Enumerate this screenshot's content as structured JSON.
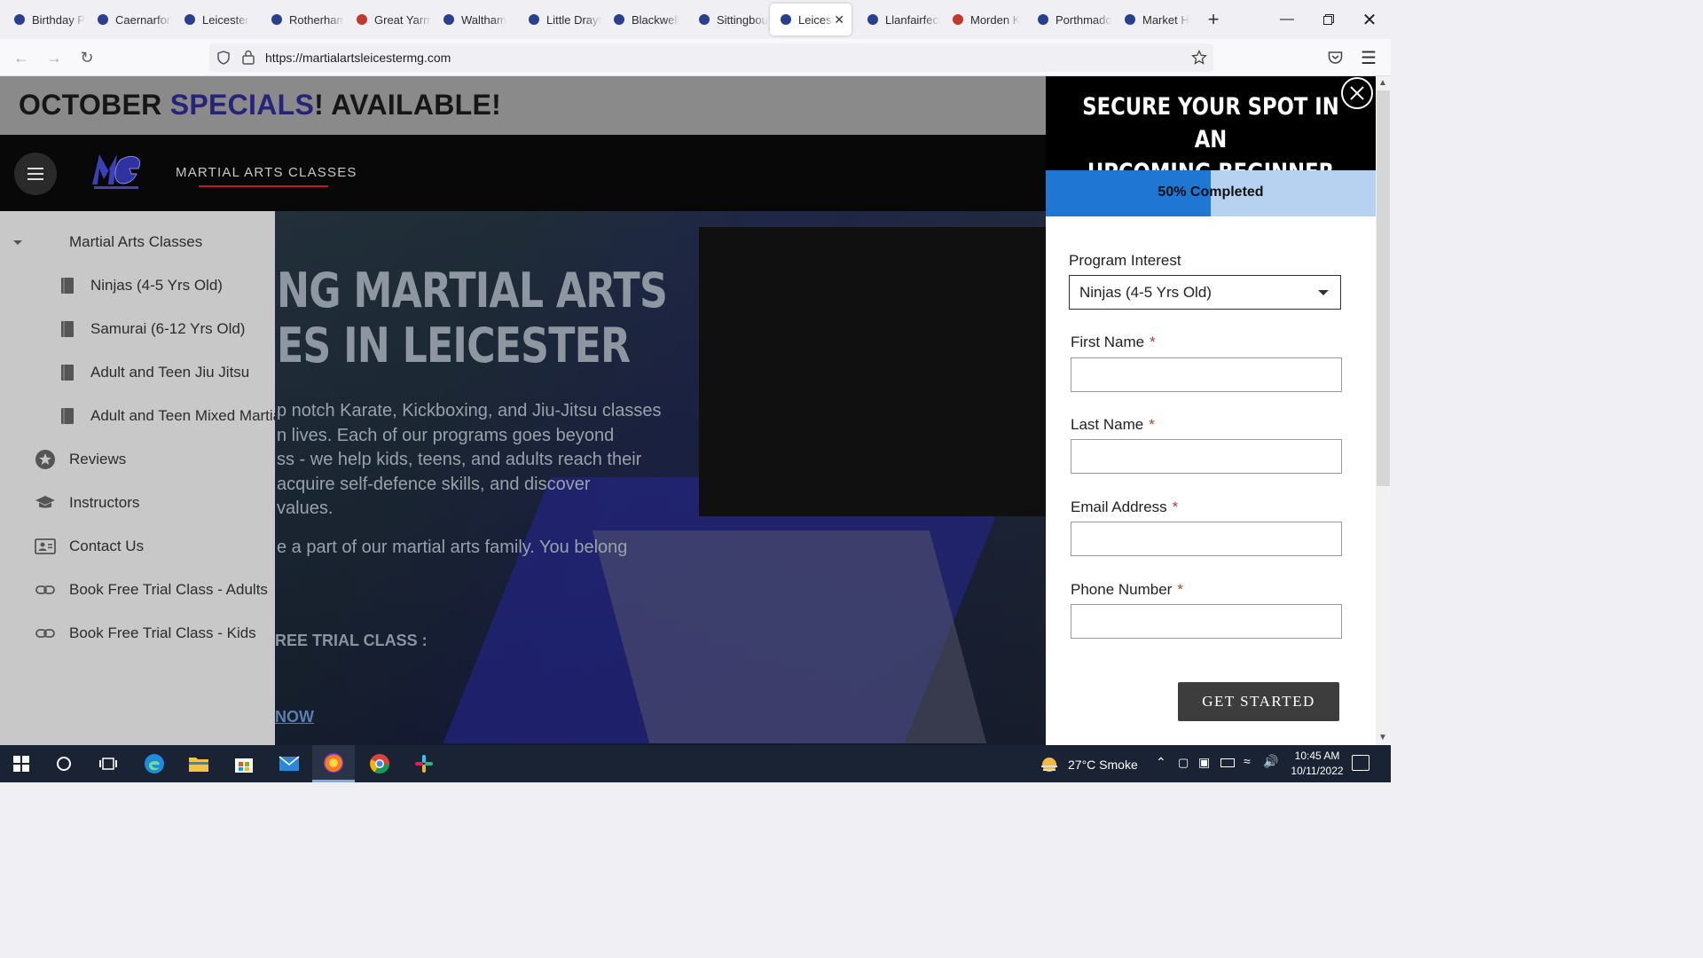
{
  "browser": {
    "tabs": [
      {
        "label": "Birthday P",
        "favicon": "account-circle-icon",
        "active": false
      },
      {
        "label": "Caernarfon",
        "favicon": "pma-icon",
        "active": false
      },
      {
        "label": "Leicester",
        "favicon": "shield-logo-icon",
        "active": false
      },
      {
        "label": "Rotherham",
        "favicon": "dragon-icon",
        "active": false
      },
      {
        "label": "Great Yarmouth",
        "favicon": "red-logo-icon",
        "active": false
      },
      {
        "label": "Waltham",
        "favicon": "ata-icon",
        "active": false
      },
      {
        "label": "Little Drayton",
        "favicon": "blue-wing-icon",
        "active": false
      },
      {
        "label": "Blackwell",
        "favicon": "fist-icon",
        "active": false
      },
      {
        "label": "Sittingbourne",
        "favicon": "circle-logo-icon",
        "active": false
      },
      {
        "label": "Leicester",
        "favicon": "mg-logo-icon",
        "active": true
      },
      {
        "label": "Llanfairfechan",
        "favicon": "pma-icon",
        "active": false
      },
      {
        "label": "Morden K",
        "favicon": "red-emblem-icon",
        "active": false
      },
      {
        "label": "Porthmadog",
        "favicon": "pma-icon",
        "active": false
      },
      {
        "label": "Market H",
        "favicon": "white-logo-icon",
        "active": false
      }
    ],
    "url": "https://martialartsleicestermg.com"
  },
  "page": {
    "banner": {
      "part1": "OCTOBER ",
      "highlight": "SPECIALS",
      "part2": "! AVAILABLE!"
    },
    "nav_link": "MARTIAL ARTS CLASSES",
    "hero": {
      "heading_line1": "NG MARTIAL ARTS",
      "heading_line2": "ES IN LEICESTER",
      "para_lines": [
        "p notch Karate, Kickboxing, and Jiu-Jitsu classes",
        "n lives. Each of our programs goes beyond",
        "ss - we help kids, teens, and adults reach their",
        "acquire self-defence skills, and discover",
        "values."
      ],
      "para2": "e a part of our martial arts family. You belong",
      "cta": "REE TRIAL CLASS :",
      "link": "NOW"
    }
  },
  "drawer": {
    "items": [
      {
        "label": "Martial Arts Classes",
        "icon": "caret-down-icon",
        "level": 0
      },
      {
        "label": "Ninjas (4-5 Yrs Old)",
        "icon": "book-icon",
        "level": 1
      },
      {
        "label": "Samurai (6-12 Yrs Old)",
        "icon": "book-icon",
        "level": 1
      },
      {
        "label": "Adult and Teen Jiu Jitsu",
        "icon": "book-icon",
        "level": 1
      },
      {
        "label": "Adult and Teen Mixed Martial Arts",
        "icon": "book-icon",
        "level": 1
      },
      {
        "label": "Reviews",
        "icon": "star-icon",
        "level": 0
      },
      {
        "label": "Instructors",
        "icon": "graduation-cap-icon",
        "level": 0
      },
      {
        "label": "Contact Us",
        "icon": "contact-card-icon",
        "level": 0
      },
      {
        "label": "Book Free Trial Class - Adults",
        "icon": "link-icon",
        "level": 0
      },
      {
        "label": "Book Free Trial Class - Kids",
        "icon": "link-icon",
        "level": 0
      }
    ]
  },
  "popup": {
    "title_line1": "SECURE YOUR SPOT IN AN",
    "title_line2": "UPCOMING BEGINNER CLASS",
    "progress_label": "50% Completed",
    "progress_fraction": 0.5,
    "fields": {
      "program_label": "Program Interest",
      "program_value": "Ninjas (4-5 Yrs Old)",
      "first_name_label": "First Name",
      "last_name_label": "Last Name",
      "email_label": "Email Address",
      "phone_label": "Phone Number",
      "required_mark": "*"
    },
    "submit_label": "GET STARTED"
  },
  "taskbar": {
    "weather": "27°C  Smoke",
    "time": "10:45 AM",
    "date": "10/11/2022"
  },
  "colors": {
    "accent_blue": "#1f76d3",
    "progress_track": "#b6d2f0",
    "banner_highlight": "#25237a",
    "nav_underline": "#b41e2d"
  }
}
